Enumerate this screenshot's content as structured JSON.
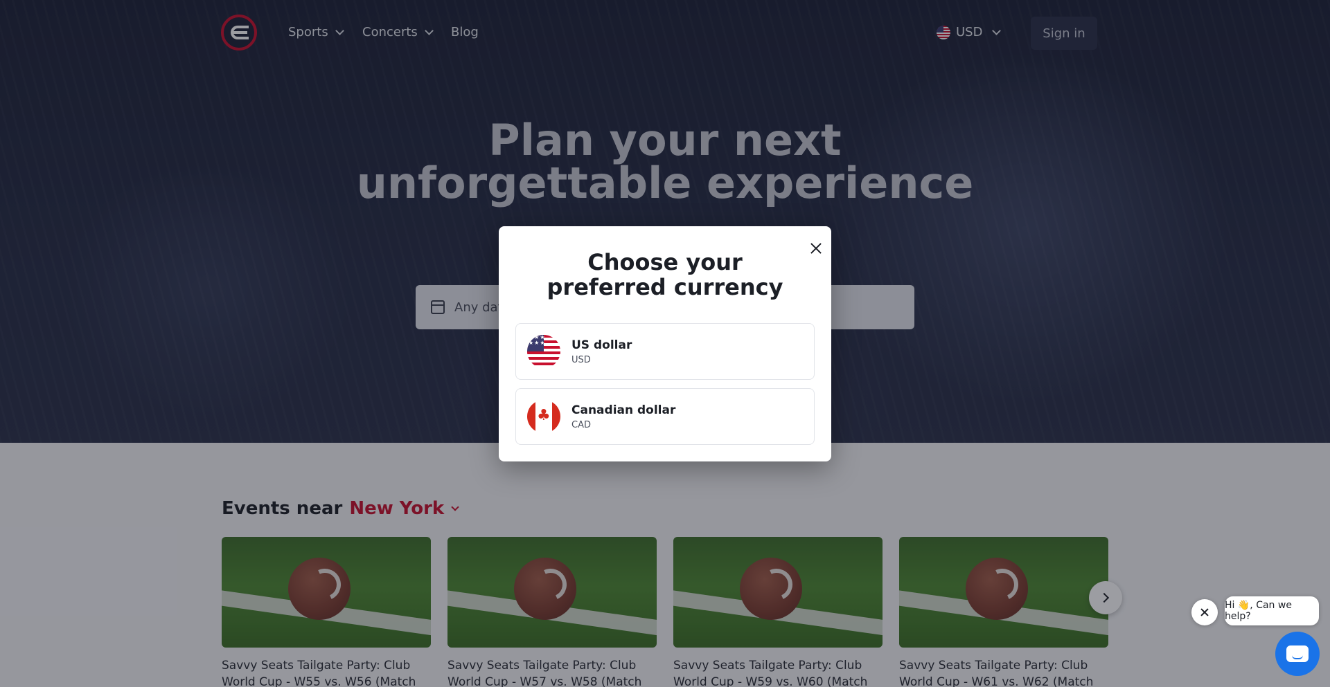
{
  "nav": {
    "sports_label": "Sports",
    "concerts_label": "Concerts",
    "blog_label": "Blog",
    "currency_label": "USD",
    "signin_label": "Sign in"
  },
  "hero": {
    "title_line1": "Plan your next",
    "title_line2": "unforgettable experience",
    "date_placeholder": "Any date"
  },
  "events": {
    "heading": "Events near",
    "city": "New York",
    "cards": [
      {
        "title": "Savvy Seats Tailgate Party: Club World Cup - W55 vs. W56 (Match"
      },
      {
        "title": "Savvy Seats Tailgate Party: Club World Cup - W57 vs. W58 (Match"
      },
      {
        "title": "Savvy Seats Tailgate Party: Club World Cup - W59 vs. W60 (Match"
      },
      {
        "title": "Savvy Seats Tailgate Party: Club World Cup - W61 vs. W62 (Match"
      }
    ]
  },
  "modal": {
    "title": "Choose your preferred currency",
    "options": [
      {
        "name": "US dollar",
        "code": "USD",
        "icon": "us-flag-icon"
      },
      {
        "name": "Canadian dollar",
        "code": "CAD",
        "icon": "canada-flag-icon"
      }
    ]
  },
  "chat": {
    "prompt": "Hi 👋, Can we help?"
  },
  "colors": {
    "brand_red": "#c8102e",
    "hero_bg": "#1d2236",
    "chat_blue": "#1a73e8"
  }
}
